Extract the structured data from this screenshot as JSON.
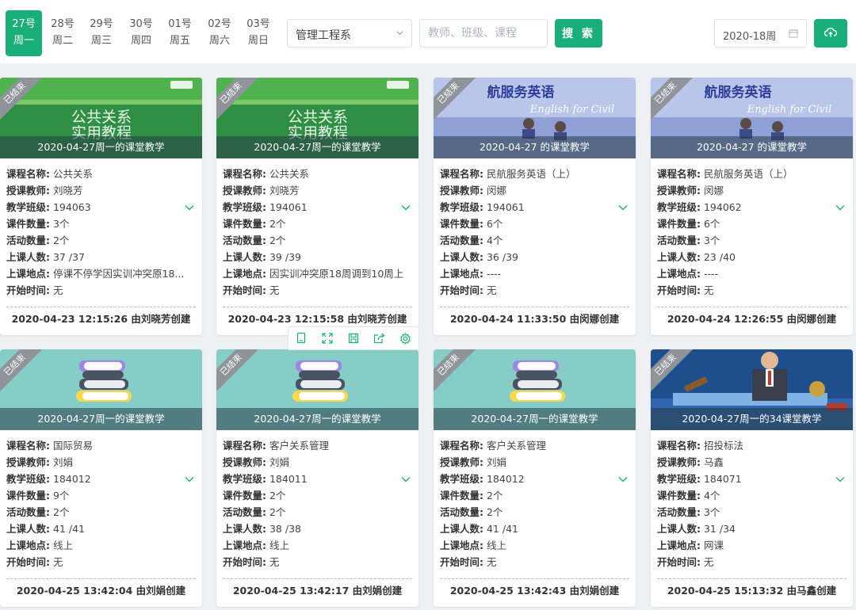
{
  "days": [
    {
      "date": "27号",
      "weekday": "周一",
      "active": true
    },
    {
      "date": "28号",
      "weekday": "周二"
    },
    {
      "date": "29号",
      "weekday": "周三"
    },
    {
      "date": "30号",
      "weekday": "周四"
    },
    {
      "date": "01号",
      "weekday": "周五"
    },
    {
      "date": "02号",
      "weekday": "周六"
    },
    {
      "date": "03号",
      "weekday": "周日"
    }
  ],
  "filters": {
    "department": "管理工程系",
    "search_placeholder": "教师、班级、课程",
    "search_label": "搜 索",
    "week": "2020-18周"
  },
  "labels": {
    "course": "课程名称:",
    "teacher": "授课教师:",
    "class": "教学班级:",
    "materials": "课件数量:",
    "activities": "活动数量:",
    "attendance": "上课人数:",
    "location": "上课地点:",
    "start": "开始时间:",
    "ended": "已结束"
  },
  "cards": [
    {
      "title": "2020-04-27周一的课堂教学",
      "course": "公共关系",
      "teacher": "刘晓芳",
      "class": "194063",
      "materials": "3个",
      "activities": "2个",
      "attendance": "37 /37",
      "location": "停课不停学因实训冲突原18...",
      "start": "无",
      "footer": "2020-04-23 12:15:26 由刘晓芳创建",
      "cover": "green"
    },
    {
      "title": "2020-04-27周一的课堂教学",
      "course": "公共关系",
      "teacher": "刘晓芳",
      "class": "194061",
      "materials": "2个",
      "activities": "2个",
      "attendance": "39 /39",
      "location": "因实训冲突原18周调到10周上",
      "start": "无",
      "footer": "2020-04-23 12:15:58 由刘晓芳创建",
      "cover": "green"
    },
    {
      "title": "2020-04-27 的课堂教学",
      "course": "民航服务英语（上）",
      "teacher": "闵娜",
      "class": "194061",
      "materials": "6个",
      "activities": "4个",
      "attendance": "36 /39",
      "location": "----",
      "start": "无",
      "footer": "2020-04-24 11:33:50 由闵娜创建",
      "cover": "aviation"
    },
    {
      "title": "2020-04-27 的课堂教学",
      "course": "民航服务英语（上）",
      "teacher": "闵娜",
      "class": "194062",
      "materials": "6个",
      "activities": "3个",
      "attendance": "23 /40",
      "location": "----",
      "start": "无",
      "footer": "2020-04-24 12:26:55 由闵娜创建",
      "cover": "aviation"
    },
    {
      "title": "2020-04-27周一的课堂教学",
      "course": "国际贸易",
      "teacher": "刘娟",
      "class": "184012",
      "materials": "9个",
      "activities": "2个",
      "attendance": "41 /41",
      "location": "线上",
      "start": "无",
      "footer": "2020-04-25 13:42:04 由刘娟创建",
      "cover": "books"
    },
    {
      "title": "2020-04-27周一的课堂教学",
      "course": "客户关系管理",
      "teacher": "刘娟",
      "class": "184011",
      "materials": "2个",
      "activities": "2个",
      "attendance": "38 /38",
      "location": "线上",
      "start": "无",
      "footer": "2020-04-25 13:42:17 由刘娟创建",
      "cover": "books"
    },
    {
      "title": "2020-04-27周一的课堂教学",
      "course": "客户关系管理",
      "teacher": "刘娟",
      "class": "184012",
      "materials": "2个",
      "activities": "2个",
      "attendance": "41 /41",
      "location": "线上",
      "start": "无",
      "footer": "2020-04-25 13:42:43 由刘娟创建",
      "cover": "books"
    },
    {
      "title": "2020-04-27周一的34课堂教学",
      "course": "招投标法",
      "teacher": "马鑫",
      "class": "184071",
      "materials": "4个",
      "activities": "3个",
      "attendance": "31 /34",
      "location": "网课",
      "start": "无",
      "footer": "2020-04-25 15:13:32 由马鑫创建",
      "cover": "auction"
    }
  ],
  "cover_text": {
    "green": {
      "line1": "公共关系",
      "line2": "实用教程"
    },
    "aviation": {
      "line1": "航服务英语",
      "line2": "English for Civil"
    }
  },
  "toolbar_icons": [
    "copy-icon",
    "fullscreen-icon",
    "save-icon",
    "share-icon",
    "settings-icon"
  ],
  "colors": {
    "accent": "#1aaf7a",
    "ribbon": "#8e9499"
  }
}
